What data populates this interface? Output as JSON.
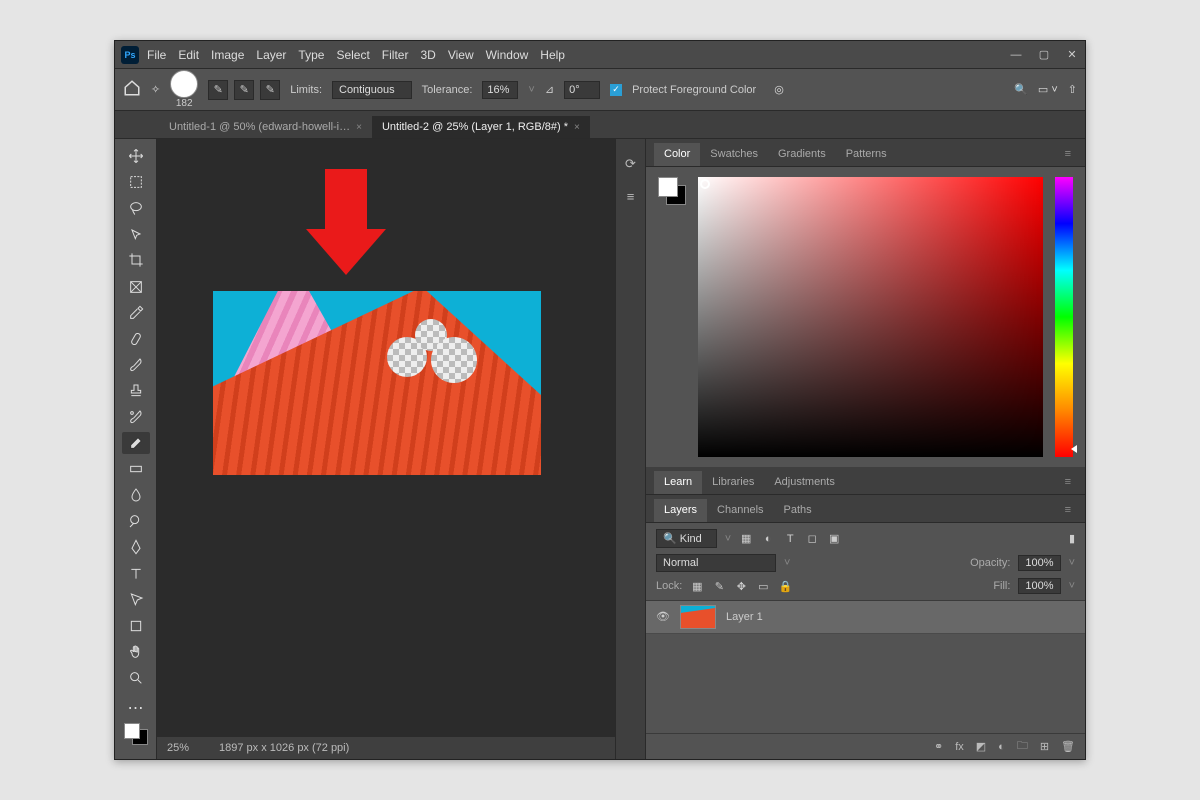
{
  "menu": [
    "File",
    "Edit",
    "Image",
    "Layer",
    "Type",
    "Select",
    "Filter",
    "3D",
    "View",
    "Window",
    "Help"
  ],
  "options": {
    "brush_size": "182",
    "limits_label": "Limits:",
    "limits_value": "Contiguous",
    "tolerance_label": "Tolerance:",
    "tolerance_value": "16%",
    "angle_symbol": "⊿",
    "angle_value": "0°",
    "protect_label": "Protect Foreground Color"
  },
  "tabs": {
    "tab1": "Untitled-1 @ 50% (edward-howell-i…",
    "tab2": "Untitled-2 @ 25% (Layer 1, RGB/8#) *"
  },
  "status": {
    "zoom": "25%",
    "dims": "1897 px x 1026 px (72 ppi)"
  },
  "color_panel": {
    "tab_color": "Color",
    "tab_swatches": "Swatches",
    "tab_gradients": "Gradients",
    "tab_patterns": "Patterns"
  },
  "mid1": {
    "tab_learn": "Learn",
    "tab_libraries": "Libraries",
    "tab_adjustments": "Adjustments"
  },
  "mid2": {
    "tab_layers": "Layers",
    "tab_channels": "Channels",
    "tab_paths": "Paths"
  },
  "layers": {
    "kind_prefix": "🔍 Kind",
    "blend": "Normal",
    "opacity_label": "Opacity:",
    "opacity_value": "100%",
    "lock_label": "Lock:",
    "fill_label": "Fill:",
    "fill_value": "100%",
    "layer1_name": "Layer 1",
    "footer_fx": "fx"
  }
}
